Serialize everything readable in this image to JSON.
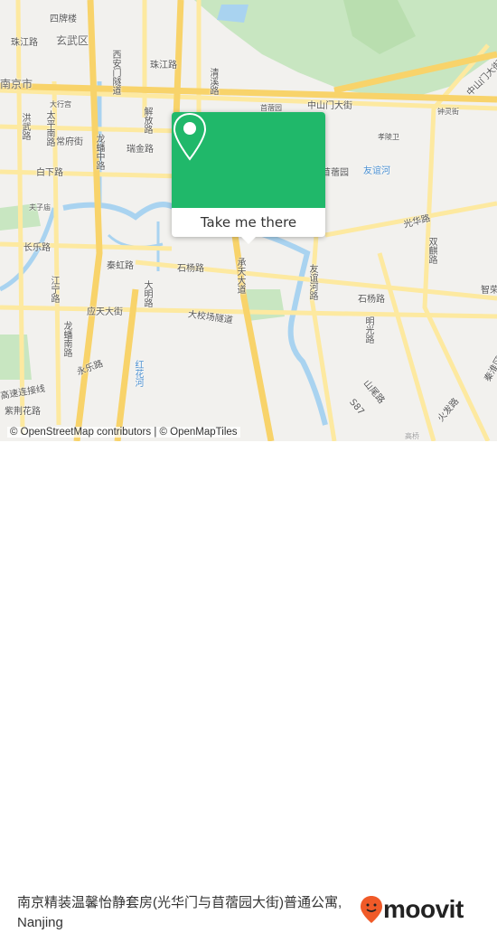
{
  "map": {
    "labels": [
      "四牌楼",
      "玄武区",
      "珠江路",
      "珠江路",
      "西安门隧道",
      "清溪路",
      "中山门大街",
      "中山门大街",
      "钟灵街",
      "大行宫",
      "洪武路",
      "太平南路",
      "常府街",
      "龙蟠中路",
      "解放路",
      "瑞金路",
      "白下路",
      "孝陵卫",
      "友谊河",
      "光华路",
      "长乐路",
      "夫子庙",
      "秦虹路",
      "石杨路",
      "承天大道",
      "友谊河路",
      "石杨路",
      "双麒路",
      "应天大街",
      "大校场隧道",
      "大明路",
      "江宁路",
      "龙蟠南路",
      "永乐路",
      "红花河",
      "高速连接线",
      "紫荆花路",
      "秦淮区",
      "钟灵街",
      "南京市",
      "首蓿园",
      "苜蓿园",
      "明光路",
      "山尾路",
      "S87",
      "火发路",
      "高桥",
      "智荣"
    ],
    "colors": {
      "park": "#c8e6c1",
      "water": "#a9d3f0",
      "road": "#fde9a0",
      "road_major": "#f8d36a",
      "popup": "#20b86a"
    }
  },
  "popup": {
    "icon": "location-pin-icon",
    "cta": "Take me there"
  },
  "attribution": "© OpenStreetMap contributors | © OpenMapTiles",
  "footer": {
    "title": "南京精装温馨怡静套房(光华门与苜蓿园大街)普通公寓, Nanjing",
    "brand": "moovit",
    "brand_color": "#f05a28"
  }
}
